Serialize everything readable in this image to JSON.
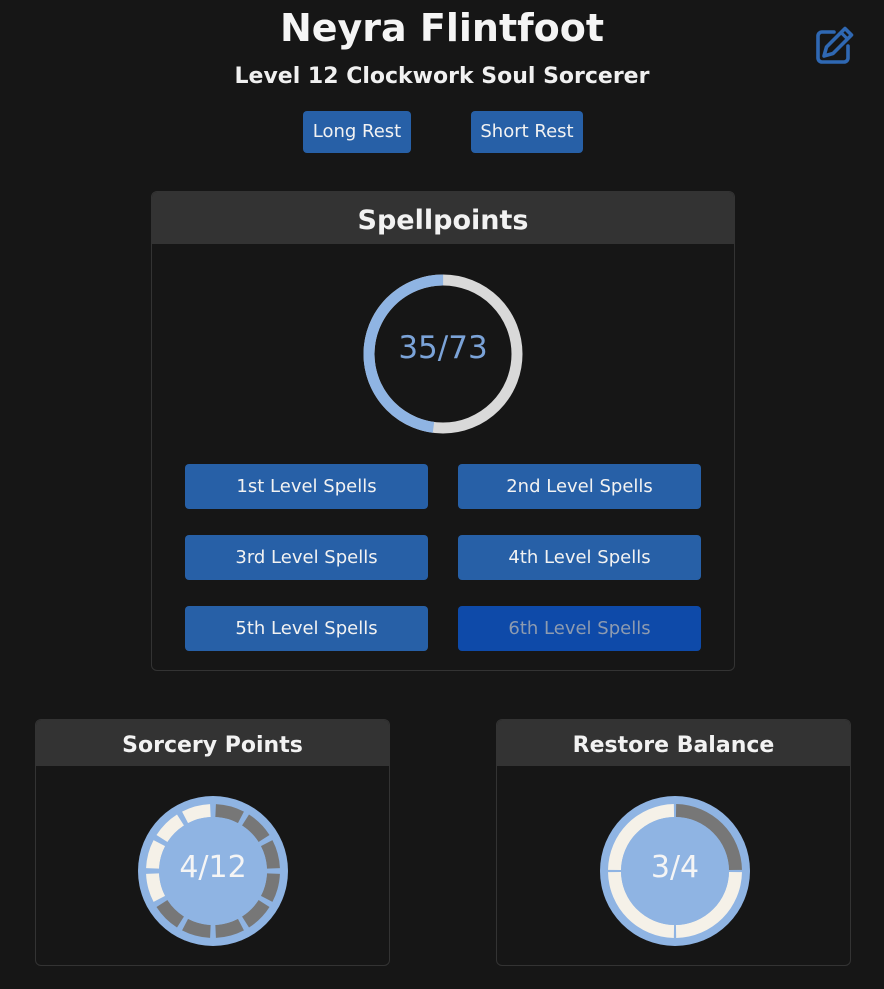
{
  "character": {
    "name": "Neyra Flintfoot",
    "subtitle": "Level 12 Clockwork Soul Sorcerer"
  },
  "icons": {
    "edit": "edit-icon"
  },
  "rest_buttons": {
    "long_rest": "Long Rest",
    "short_rest": "Short Rest"
  },
  "spellpoints": {
    "title": "Spellpoints",
    "current": 35,
    "max": 73,
    "display": "35/73",
    "spell_levels": [
      "1st Level Spells",
      "2nd Level Spells",
      "3rd Level Spells",
      "4th Level Spells",
      "5th Level Spells",
      "6th Level Spells"
    ],
    "active_level_index": 5
  },
  "sorcery_points": {
    "title": "Sorcery Points",
    "current": 4,
    "max": 12,
    "display": "4/12"
  },
  "restore_balance": {
    "title": "Restore Balance",
    "current": 3,
    "max": 4,
    "display": "3/4"
  },
  "colors": {
    "background": "#161616",
    "accent_blue": "#2760a7",
    "active_blue": "#0e4aa9",
    "ring_blue": "#8fb4e3",
    "ring_grey": "#d9d9d9",
    "segment_used": "#777777",
    "segment_available": "#f5f1e8",
    "panel_header": "#333333"
  }
}
